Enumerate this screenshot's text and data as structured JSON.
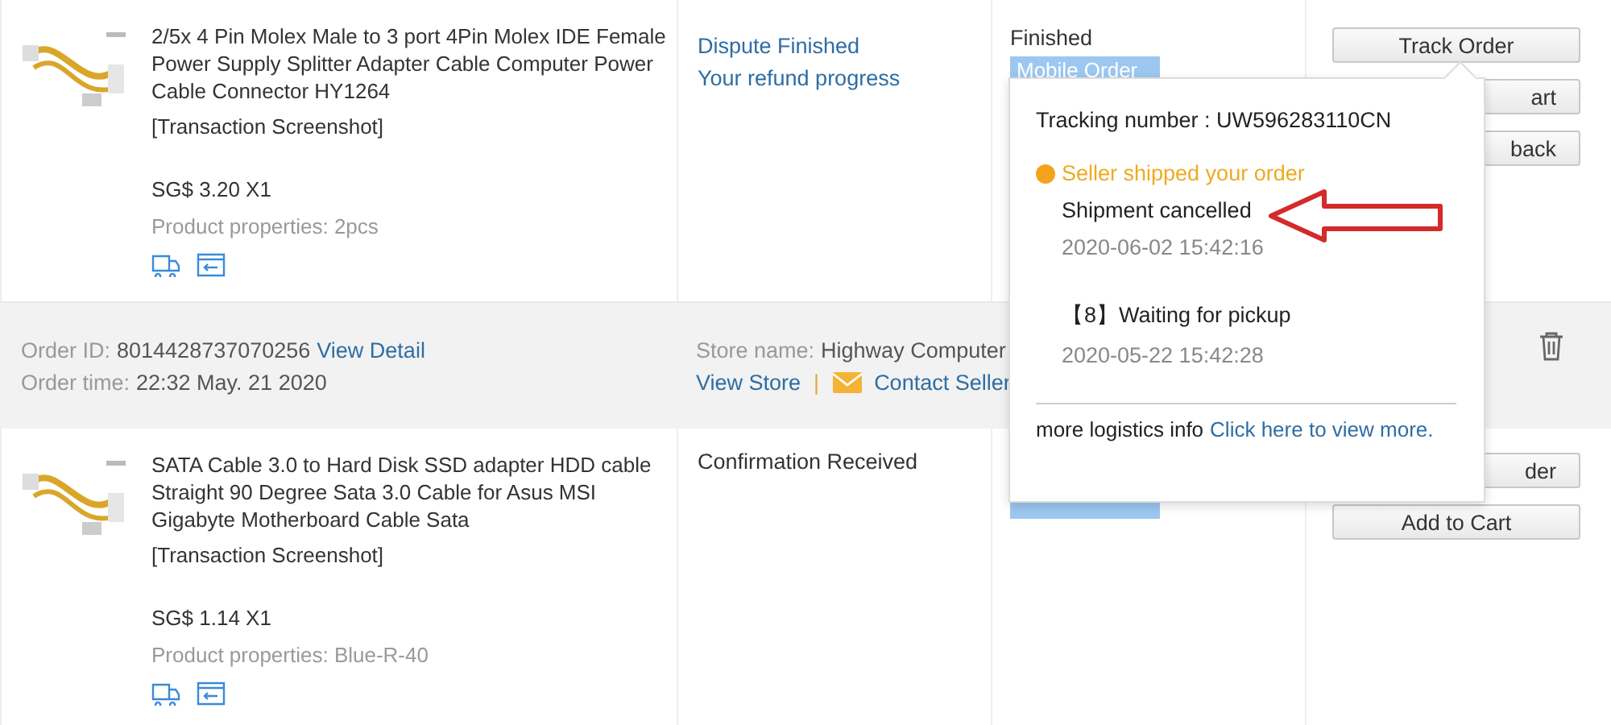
{
  "rows": [
    {
      "kind": "item",
      "title": "2/5x 4 Pin Molex Male to 3 port 4Pin Molex IDE Female Power Supply Splitter Adapter Cable Computer Power Cable Connector HY1264",
      "note": "[Transaction Screenshot]",
      "price": "SG$ 3.20 X1",
      "properties": "Product properties: 2pcs",
      "status_lines": [
        {
          "text": "Dispute Finished",
          "kind": "link"
        },
        {
          "text": "Your refund progress",
          "kind": "link"
        }
      ],
      "order_status": "Finished",
      "badge": "Mobile Order",
      "buttons": [
        {
          "label": "Track Order",
          "kind": "full"
        },
        {
          "label": "art",
          "kind": "partial"
        },
        {
          "label": "back",
          "kind": "partial"
        }
      ]
    },
    {
      "kind": "header",
      "order_id_label": "Order ID:",
      "order_id": "8014428737070256",
      "view_detail": "View Detail",
      "time_label": "Order time:",
      "time": "22:32 May. 21 2020",
      "store_label": "Store name:",
      "store": "Highway Computer",
      "view_store": "View Store",
      "separator": "|",
      "contact": "Contact Seller"
    },
    {
      "kind": "item",
      "title": "SATA Cable 3.0 to Hard Disk SSD adapter HDD cable Straight 90 Degree Sata 3.0 Cable for Asus MSI Gigabyte Motherboard Cable Sata",
      "note": "[Transaction Screenshot]",
      "price": "SG$ 1.14 X1",
      "properties": "Product properties: Blue-R-40",
      "status_lines": [
        {
          "text": "Confirmation Received",
          "kind": "text"
        }
      ],
      "buttons": [
        {
          "label": "der",
          "kind": "partial"
        },
        {
          "label": "Add to Cart",
          "kind": "full"
        }
      ]
    }
  ],
  "popup": {
    "tracking": "Tracking number : UW596283110CN",
    "status": "Seller shipped your order",
    "events": [
      {
        "text": "Shipment cancelled",
        "time": "2020-06-02 15:42:16",
        "annotation": {
          "kind": "arrow"
        }
      },
      {
        "text": "【8】Waiting for pickup",
        "time": "2020-05-22 15:42:28"
      }
    ],
    "footer_text": "more logistics info",
    "footer_link": "Click here to view more."
  }
}
